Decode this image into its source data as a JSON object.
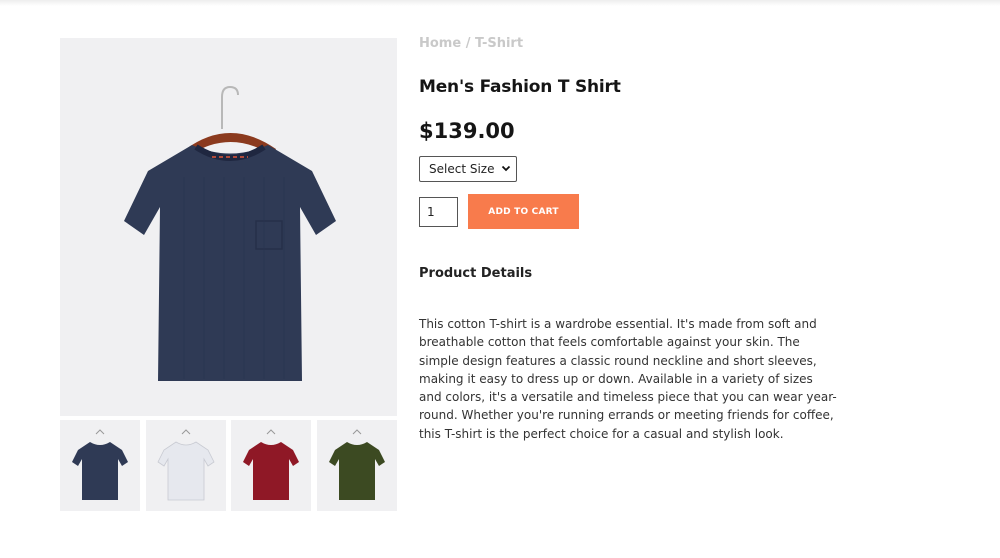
{
  "breadcrumb": {
    "home": "Home",
    "separator": "/",
    "current": "T-Shirt"
  },
  "product": {
    "title": "Men's Fashion T Shirt",
    "price": "$139.00",
    "size_select": {
      "selected": "Select Size"
    },
    "quantity": "1",
    "add_to_cart_label": "ADD TO CART",
    "details_heading": "Product Details",
    "description": "This cotton T-shirt is a wardrobe essential. It's made from soft and breathable cotton that feels comfortable against your skin. The simple design features a classic round neckline and short sleeves, making it easy to dress up or down. Available in a variety of sizes and colors, it's a versatile and timeless piece that you can wear year-round. Whether you're running errands or meeting friends for coffee, this T-shirt is the perfect choice for a casual and stylish look."
  },
  "gallery": {
    "main_color": "#2f3a55",
    "thumbnails": [
      {
        "name": "navy",
        "color": "#2f3a55"
      },
      {
        "name": "white",
        "color": "#e6e8ee"
      },
      {
        "name": "red",
        "color": "#8f1826"
      },
      {
        "name": "olive",
        "color": "#3c4a22"
      }
    ]
  },
  "colors": {
    "accent": "#f87b4c",
    "breadcrumb": "#c9c9c9"
  }
}
